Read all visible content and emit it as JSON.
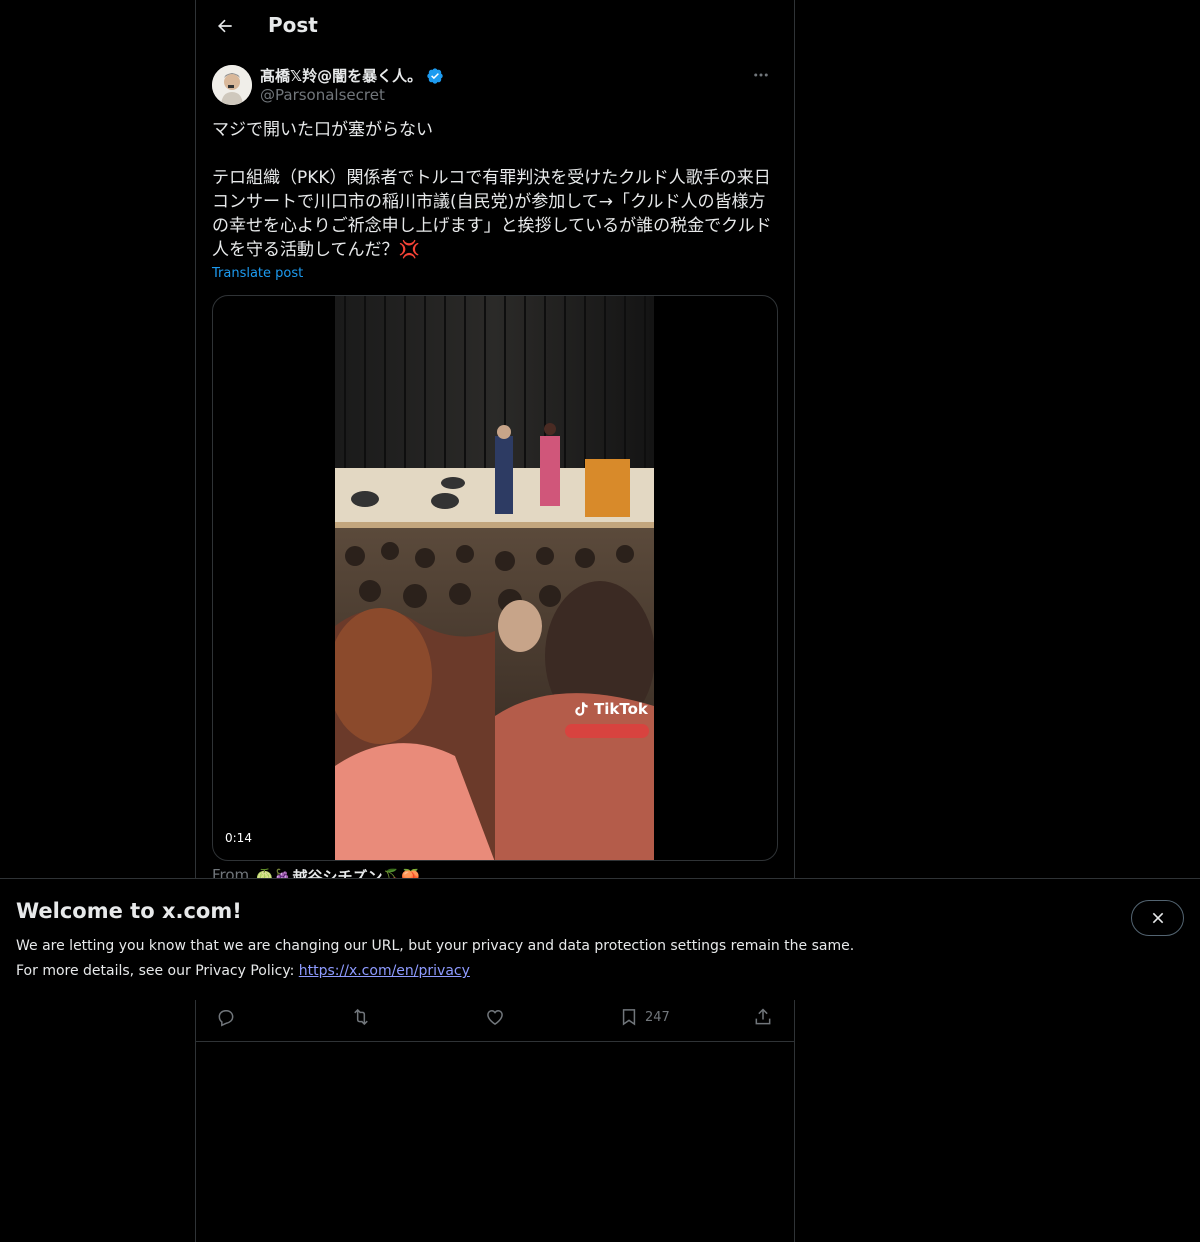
{
  "header": {
    "title": "Post"
  },
  "author": {
    "display_name": "髙橋𝕏羚@闇を暴く人。",
    "handle": "@Parsonalsecret"
  },
  "post": {
    "text": "マジで開いた口が塞がらない\n\nテロ組織（PKK）関係者でトルコで有罪判決を受けたクルド人歌手の来日コンサートで川口市の稲川市議(自民党)が参加して→「クルド人の皆様方の幸せを心よりご祈念申し上げます」と挨拶しているが誰の税金でクルド人を守る活動してんだ？💢",
    "translate_label": "Translate post"
  },
  "media": {
    "duration": "0:14",
    "watermark": "TikTok"
  },
  "from": {
    "label": "From",
    "source": "🍈🍇越谷シチズン🍒🍑"
  },
  "actions": {
    "bookmarks": "247"
  },
  "banner": {
    "title": "Welcome to x.com!",
    "line1": "We are letting you know that we are changing our URL, but your privacy and data protection settings remain the same.",
    "line2_prefix": "For more details, see our Privacy Policy: ",
    "link": "https://x.com/en/privacy"
  },
  "colors": {
    "accent": "#1d9bf0",
    "muted": "#71767b",
    "border": "#2f3336"
  }
}
